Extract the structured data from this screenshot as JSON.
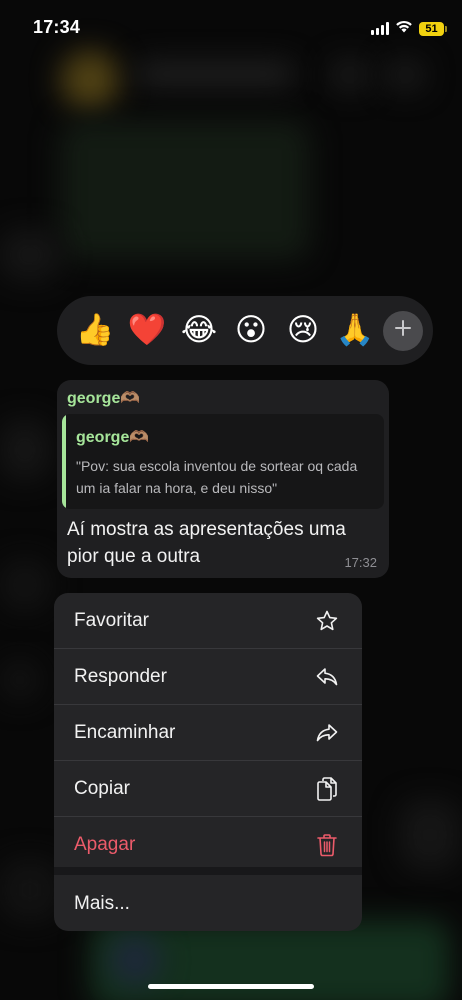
{
  "status_bar": {
    "time": "17:34",
    "battery": "51"
  },
  "reactions": {
    "items": [
      {
        "name": "thumbs-up",
        "glyph": "👍"
      },
      {
        "name": "heart",
        "glyph": "❤️"
      },
      {
        "name": "laughing",
        "glyph": "😂"
      },
      {
        "name": "surprised",
        "glyph": "😮"
      },
      {
        "name": "crying",
        "glyph": "😢"
      },
      {
        "name": "praying",
        "glyph": "🙏"
      }
    ],
    "more_icon": "plus-icon"
  },
  "message": {
    "sender": "george🫶🏽",
    "quote": {
      "author": "george🫶🏽",
      "text": "\"Pov: sua escola inventou de sortear oq cada um ia falar na hora, e deu nisso\""
    },
    "text": "Aí mostra as apresentações uma pior que a outra",
    "time": "17:32"
  },
  "context_menu": {
    "items": [
      {
        "label": "Favoritar",
        "icon": "star-icon"
      },
      {
        "label": "Responder",
        "icon": "reply-icon"
      },
      {
        "label": "Encaminhar",
        "icon": "forward-icon"
      },
      {
        "label": "Copiar",
        "icon": "copy-icon"
      },
      {
        "label": "Apagar",
        "icon": "trash-icon",
        "color": "#ec5b6a"
      }
    ],
    "more_label": "Mais..."
  },
  "colors": {
    "sender_green": "#a6e59a",
    "danger_red": "#ec5b6a",
    "battery_yellow": "#f2d20f"
  }
}
